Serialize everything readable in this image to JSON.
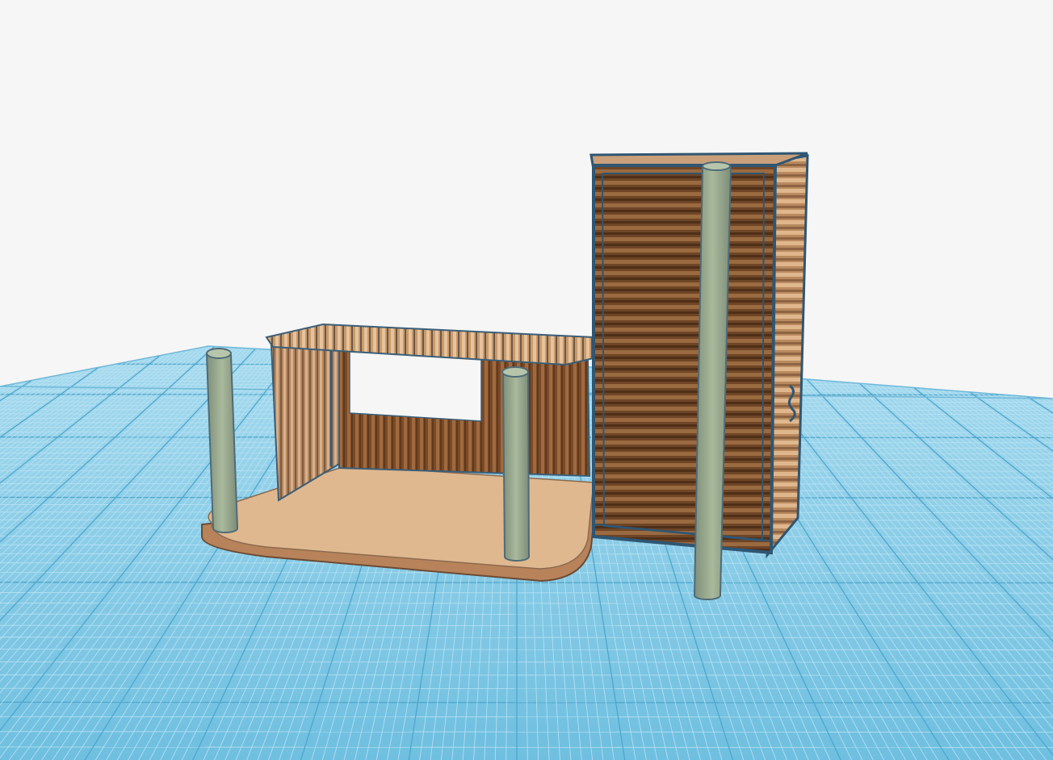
{
  "viewport": {
    "background_color": "#f6f6f6"
  },
  "workplane": {
    "color": "#8fcde6",
    "fine_grid_color": "#b9e2f2",
    "major_grid_color": "#4fa6cc"
  },
  "scene": {
    "objects": [
      {
        "name": "base-slab",
        "color": "#dfb88f",
        "edge_color": "#a37a58"
      },
      {
        "name": "left-container-shell",
        "color": "#8a5a35"
      },
      {
        "name": "corrugated-roof",
        "color": "#c79a6c"
      },
      {
        "name": "tall-container",
        "color": "#7a4c2a",
        "side_color": "#c99b6d",
        "outline_color": "#2f5673"
      },
      {
        "name": "support-pillar",
        "count": 3,
        "color": "#9aaa8e",
        "outline_color": "#4f6b77"
      }
    ]
  }
}
